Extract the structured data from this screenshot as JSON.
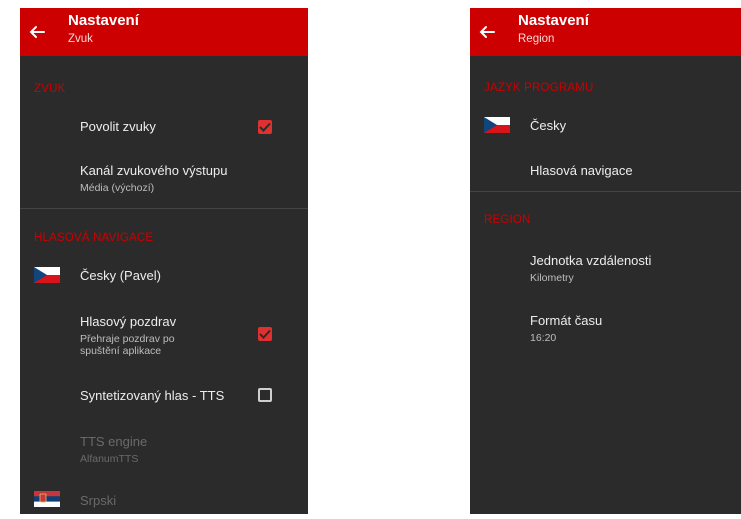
{
  "left_screen": {
    "appbar": {
      "title": "Nastavení",
      "subtitle": "Zvuk"
    },
    "sections": {
      "zvuk": "ZVUK",
      "hlasova_navigace": "HLASOVÁ NAVIGACE"
    },
    "items": {
      "povolit_zvuky": {
        "label": "Povolit zvuky",
        "checked": true
      },
      "kanal": {
        "label": "Kanál zvukového výstupu",
        "value": "Média (výchozí)"
      },
      "cesky_pavel": {
        "label": "Česky (Pavel)",
        "flag": "czech-flag"
      },
      "hlasovy_pozdrav": {
        "label": "Hlasový pozdrav",
        "desc_line1": "Přehraje pozdrav po",
        "desc_line2": "spuštění aplikace",
        "checked": true
      },
      "tts": {
        "label": "Syntetizovaný hlas - TTS",
        "checked": false
      },
      "tts_engine": {
        "label": "TTS engine",
        "value": "AlfanumTTS",
        "disabled": true
      },
      "srpski": {
        "label": "Srpski",
        "flag": "serbian-flag",
        "disabled": true
      }
    }
  },
  "right_screen": {
    "appbar": {
      "title": "Nastavení",
      "subtitle": "Region"
    },
    "sections": {
      "jazyk": "JAZYK PROGRAMU",
      "region": "REGION"
    },
    "items": {
      "cesky": {
        "label": "Česky",
        "flag": "czech-flag"
      },
      "hlasova_navigace": {
        "label": "Hlasová navigace"
      },
      "jednotka": {
        "label": "Jednotka vzdálenosti",
        "value": "Kilometry"
      },
      "format_casu": {
        "label": "Formát času",
        "value": "16:20"
      }
    }
  },
  "colors": {
    "accent": "#cc0000",
    "background": "#2b2b2b",
    "text": "#ededed"
  }
}
